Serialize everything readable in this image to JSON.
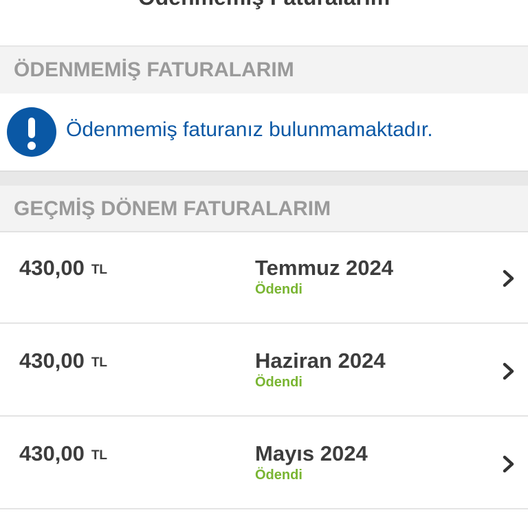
{
  "header": {
    "title": "Ödenmemiş Faturalarım"
  },
  "unpaid": {
    "heading": "ÖDENMEMİŞ FATURALARIM",
    "notice_icon": "exclamation-circle-icon",
    "notice_text": "Ödenmemiş faturanız bulunmamaktadır."
  },
  "past": {
    "heading": "GEÇMİŞ DÖNEM FATURALARIM",
    "rows": [
      {
        "amount": "430,00",
        "currency": "TL",
        "period": "Temmuz 2024",
        "status": "Ödendi"
      },
      {
        "amount": "430,00",
        "currency": "TL",
        "period": "Haziran 2024",
        "status": "Ödendi"
      },
      {
        "amount": "430,00",
        "currency": "TL",
        "period": "Mayıs 2024",
        "status": "Ödendi"
      }
    ]
  },
  "colors": {
    "accent_blue": "#0a58a5",
    "status_paid": "#79b532",
    "section_header_text": "#9a9a9a",
    "body_text": "#3d3d3d"
  }
}
